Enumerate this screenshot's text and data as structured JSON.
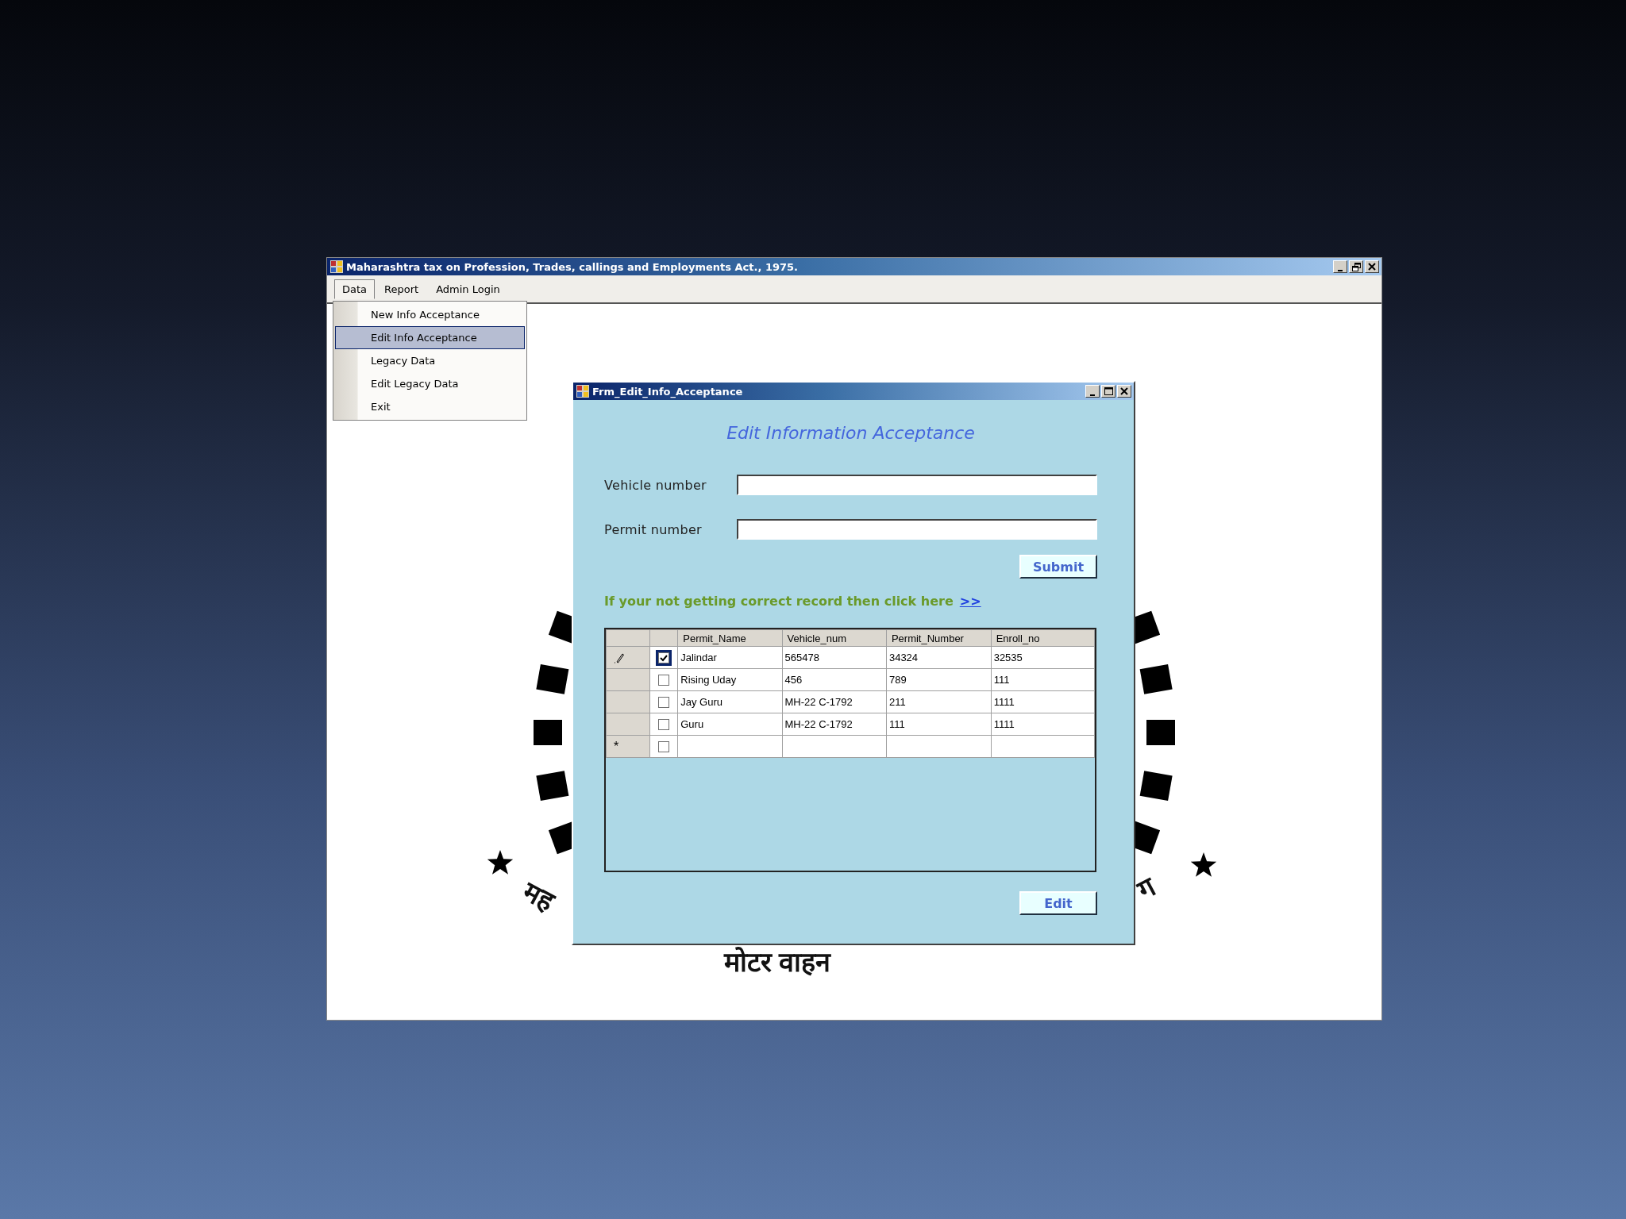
{
  "window": {
    "title": "Maharashtra tax on Profession, Trades, callings and Employments Act., 1975.",
    "maximized": true
  },
  "menu_bar": [
    {
      "label": "Data",
      "selected": true
    },
    {
      "label": "Report",
      "selected": false
    },
    {
      "label": "Admin Login",
      "selected": false
    }
  ],
  "menu_items": [
    {
      "label": "New Info Acceptance",
      "selected": false
    },
    {
      "label": "Edit Info Acceptance",
      "selected": true
    },
    {
      "label": "Legacy Data",
      "selected": false
    },
    {
      "label": "Edit Legacy Data",
      "selected": false
    },
    {
      "label": "Exit",
      "selected": false
    }
  ],
  "emblem": {
    "texts": [
      "मह",
      "ग",
      "मोटर वाहन"
    ]
  },
  "dialog": {
    "title": "Frm_Edit_Info_Acceptance",
    "maximized": false,
    "heading": "Edit Information Acceptance",
    "fields": [
      {
        "label": "Vehicle number"
      },
      {
        "label": "Permit number"
      }
    ],
    "submit": "Submit",
    "hint": "If your not getting correct record then click here",
    "link": ">>",
    "grid": {
      "columns": [
        "Permit_Name",
        "Vehicle_num",
        "Permit_Number",
        "Enroll_no"
      ],
      "rows": [
        {
          "editing": true,
          "checked": true,
          "cells": [
            "Jalindar",
            "565478",
            "34324",
            "32535"
          ]
        },
        {
          "editing": false,
          "checked": false,
          "cells": [
            "Rising Uday",
            "456",
            "789",
            "111"
          ]
        },
        {
          "editing": false,
          "checked": false,
          "cells": [
            "Jay Guru",
            "MH-22 C-1792",
            "211",
            "1111"
          ]
        },
        {
          "editing": false,
          "checked": false,
          "cells": [
            "Guru",
            "MH-22 C-1792",
            "111",
            "1111"
          ]
        }
      ],
      "new_row": {
        "marker": "*",
        "checked": false
      }
    },
    "edit_button": "Edit"
  }
}
